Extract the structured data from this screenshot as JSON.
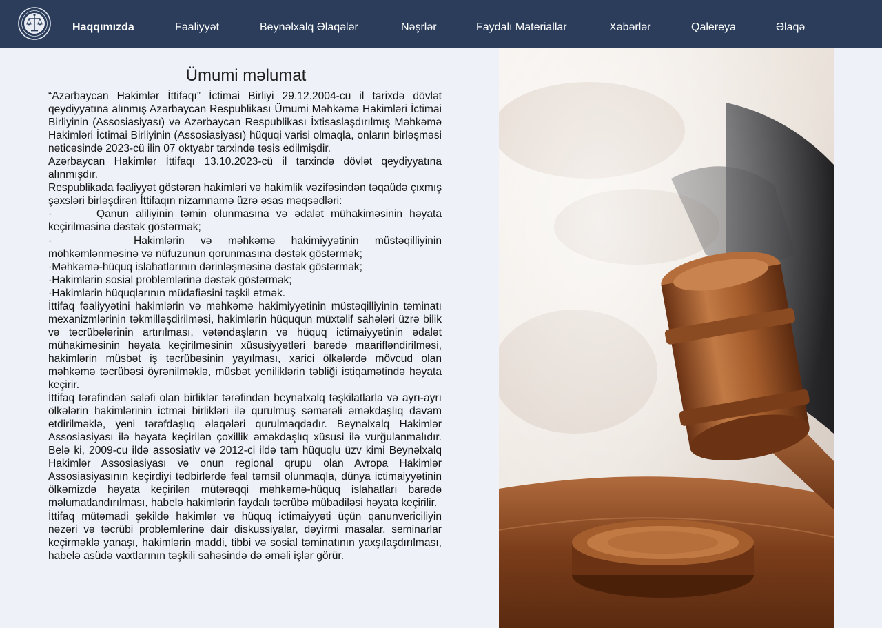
{
  "nav": {
    "logo_icon": "judiciary-emblem-icon",
    "items": [
      {
        "label": "Haqqımızda",
        "active": true
      },
      {
        "label": "Fəaliyyət"
      },
      {
        "label": "Beynəlxalq Əlaqələr"
      },
      {
        "label": "Nəşrlər"
      },
      {
        "label": "Faydalı Materiallar"
      },
      {
        "label": "Xəbərlər"
      },
      {
        "label": "Qalereya"
      },
      {
        "label": "Əlaqə"
      }
    ]
  },
  "main": {
    "title": "Ümumi məlumat",
    "paragraphs": [
      "“Azərbaycan Hakimlər İttifaqı” İctimai Birliyi 29.12.2004-cü il tarixdə dövlət qeydiyyatına alınmış Azərbaycan Respublikası Ümumi Məhkəmə Hakimləri İctimai Birliyinin (Assosiasiyası) və Azərbaycan Respublikası İxtisaslaşdırılmış Məhkəmə Hakimləri İctimai Birliyinin (Assosiasiyası) hüquqi varisi olmaqla, onların birləşməsi nəticəsində 2023-cü ilin 07 oktyabr tarxində təsis edilmişdir.",
      "Azərbaycan Hakimlər İttifaqı 13.10.2023-cü il tarxində dövlət qeydiyyatına alınmışdır.",
      "Respublikada fəaliyyət göstərən hakimləri və hakimlik vəzifəsindən təqaüdə çıxmış şəxsləri birləşdirən İttifaqın nizamnamə üzrə əsas məqsədləri:"
    ],
    "bullets": [
      {
        "text": "Qanun aliliyinin təmin olunmasına və ədalət mühakiməsinin həyata keçirilməsinə dəstək göstərmək;"
      },
      {
        "text": "Hakimlərin və məhkəmə hakimiyyətinin müstəqilliyinin möhkəmlənməsinə və nüfuzunun qorunmasına dəstək göstərmək;"
      },
      {
        "text": "Məhkəmə-hüquq islahatlarının dərinləşməsinə dəstək göstərmək;"
      },
      {
        "text": "Hakimlərin sosial problemlərinə dəstək göstərmək;"
      },
      {
        "text": "Hakimlərin hüquqlarının müdafiəsini təşkil etmək."
      }
    ],
    "bullet_marker": "·",
    "paragraphs_after": [
      "İttifaq fəaliyyətini hakimlərin və məhkəmə hakimiyyətinin müstəqilliyinin təminatı mexanizmlərinin təkmilləşdirilməsi, hakimlərin hüququn müxtəlif sahələri üzrə bilik və təcrübələrinin artırılması, vətəndaşların və hüquq ictimaiyyətinin ədalət mühakiməsinin həyata keçirilməsinin xüsusiyyətləri barədə maarifləndirilməsi, hakimlərin müsbət iş təcrübəsinin yayılması, xarici ölkələrdə mövcud olan məhkəmə təcrübəsi öyrənilməklə, müsbət yeniliklərin təbliği istiqamətində həyata keçirir.",
      "İttifaq tərəfindən sələfi olan birliklər tərəfindən beynəlxalq təşkilatlarla və ayrı-ayrı ölkələrin hakimlərinin ictmai birlikləri ilə qurulmuş səmərəli əməkdaşlıq davam etdirilməklə, yeni tərəfdaşlıq əlaqələri qurulmaqdadır. Beynəlxalq Hakimlər Assosiasiyası ilə həyata keçirilən çoxillik əməkdaşlıq xüsusi ilə vurğulanmalıdır. Belə ki, 2009-cu ildə assosiativ və 2012-ci ildə tam hüquqlu üzv kimi Beynəlxalq Hakimlər Assosiasiyası və onun regional qrupu olan Avropa Hakimlər Assosiasiyasının keçirdiyi tədbirlərdə fəal təmsil olunmaqla, dünya ictimaiyyətinin ölkəmizdə həyata keçirilən mütərəqqi məhkəmə-hüquq islahatları barədə məlumatlandırılması, habelə hakimlərin faydalı təcrübə mübadiləsi həyata keçirilir.",
      "İttifaq mütəmadi şəkildə hakimlər və hüquq ictimaiyyəti üçün qanunvericiliyin nəzəri və təcrübi problemlərinə dair diskussiyalar, dəyirmi masalar, seminarlar keçirməklə yanaşı, hakimlərin maddi, tibbi və sosial təminatının yaxşılaşdırılması, habelə asüdə vaxtlarının təşkili sahəsində də əməli işlər görür."
    ]
  },
  "hero": {
    "icon": "judge-gavel-photo",
    "colors": {
      "wood": "#8a4a22",
      "wood_light": "#c27a45",
      "bg": "#f1ece6"
    }
  },
  "colors": {
    "navbar_bg": "#2b3d5a",
    "page_bg": "#eef2f8",
    "text": "#141414"
  }
}
